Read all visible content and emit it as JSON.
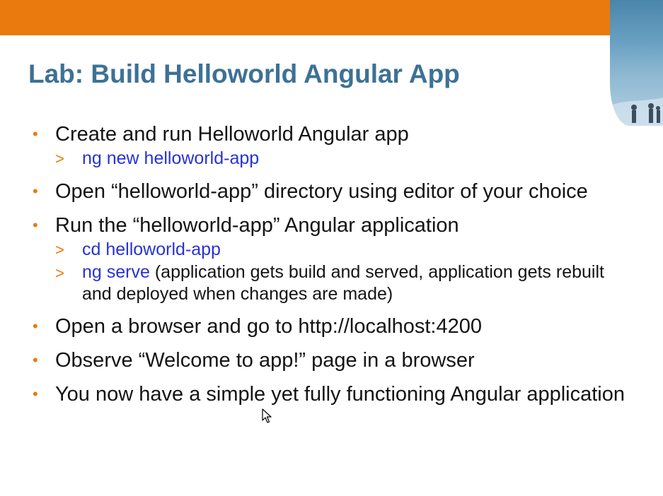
{
  "slide": {
    "title": "Lab: Build Helloworld Angular App",
    "bullets": [
      {
        "text": "Create and run Helloworld Angular app",
        "sub": [
          {
            "marker": ">",
            "cmd": "ng new helloworld-app"
          }
        ]
      },
      {
        "text": "Open “helloworld-app” directory using editor of your choice"
      },
      {
        "text": "Run the “helloworld-app” Angular application",
        "sub": [
          {
            "marker": ">",
            "cmd": "cd helloworld-app"
          },
          {
            "marker": ">",
            "cmd": "ng serve",
            "rest": " (application gets build and served, application gets rebuilt",
            "rest2": "and deployed when changes are made)"
          }
        ]
      },
      {
        "text": "Open a browser and go to http://localhost:4200"
      },
      {
        "text": "Observe “Welcome to app!” page in a browser"
      },
      {
        "text": "You now have a simple yet fully functioning Angular application"
      }
    ]
  },
  "colors": {
    "accent_bar": "#ea7a0d",
    "title": "#3d7196",
    "body_text": "#141414",
    "command": "#2733d6",
    "bullet": "#ea7a0d"
  },
  "icons": {
    "cursor": "mouse-pointer-icon",
    "corner_image": "decorative-photo"
  }
}
